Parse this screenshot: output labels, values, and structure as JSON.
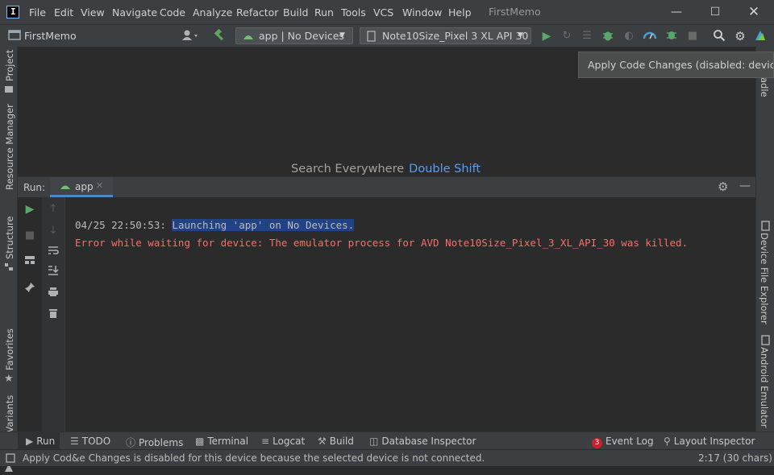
{
  "menu": {
    "items": [
      "File",
      "Edit",
      "View",
      "Navigate",
      "Code",
      "Analyze",
      "Refactor",
      "Build",
      "Run",
      "Tools",
      "VCS",
      "Window",
      "Help"
    ],
    "window_title": "FirstMemo"
  },
  "toolbar": {
    "project_name": "FirstMemo",
    "run_config": "app | No Devices",
    "device": "Note10Size_Pixel 3 XL API 30"
  },
  "tooltip": {
    "text": "Apply Code Changes (disabled: device not"
  },
  "editor": {
    "search_label": "Search Everywhere",
    "search_shortcut": "Double Shift"
  },
  "left_tabs": [
    "Project",
    "Resource Manager",
    "Structure",
    "Favorites",
    "Build Variants"
  ],
  "right_tabs": [
    "adle",
    "Device File Explorer",
    "Android Emulator"
  ],
  "run_panel": {
    "label": "Run:",
    "tab_label": "app",
    "line1_prefix": "04/25 22:50:53: ",
    "line1_selected": "Launching 'app' on No Devices.",
    "line2": "Error while waiting for device: The emulator process for AVD Note10Size_Pixel_3_XL_API_30 was killed."
  },
  "bottom_tabs": {
    "run": "Run",
    "todo": "TODO",
    "problems": "Problems",
    "terminal": "Terminal",
    "logcat": "Logcat",
    "build": "Build",
    "database": "Database Inspector",
    "event_log_count": "3",
    "event_log": "Event Log",
    "layout_inspector": "Layout Inspector"
  },
  "status": {
    "message": "Apply Cod&e Changes is disabled for this device because the selected device is not connected.",
    "position": "2:17 (30 chars)"
  },
  "colors": {
    "accent_blue": "#589df6",
    "run_green": "#59a869",
    "error_red": "#ff6b68",
    "selection": "#214283",
    "build_green": "#4caf50"
  }
}
